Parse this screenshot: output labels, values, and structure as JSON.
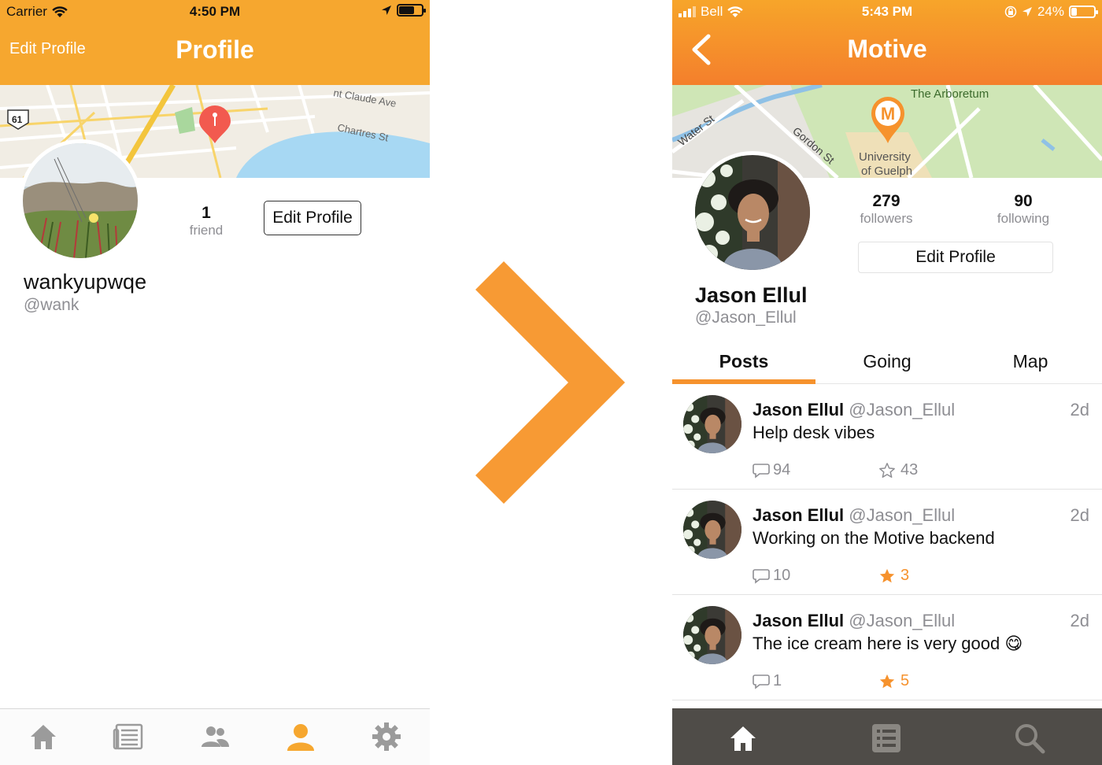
{
  "colors": {
    "accent": "#f6a72f",
    "accent_dark": "#f47f2c",
    "tab_active": "#f6922d",
    "dark_tabbar": "#4f4c48"
  },
  "left": {
    "status": {
      "carrier": "Carrier",
      "time": "4:50 PM"
    },
    "header": {
      "left_button": "Edit Profile",
      "title": "Profile"
    },
    "map": {
      "labels": [
        "Claude Ave",
        "Chartres St"
      ],
      "route_shield": "61"
    },
    "profile": {
      "stat_value": "1",
      "stat_label": "friend",
      "edit_button": "Edit Profile",
      "name": "wankyupwqe",
      "handle": "@wank"
    },
    "tabbar": {
      "icons": [
        "home-icon",
        "news-icon",
        "friends-icon",
        "profile-icon",
        "settings-icon"
      ],
      "active": "profile-icon"
    }
  },
  "right": {
    "status": {
      "carrier": "Bell",
      "time": "5:43 PM",
      "battery": "24%"
    },
    "header": {
      "title": "Motive"
    },
    "map": {
      "labels": [
        "Water St",
        "Gordon St",
        "The Arboretum",
        "University",
        "of Guelph"
      ],
      "pin_letter": "M"
    },
    "profile": {
      "followers_value": "279",
      "followers_label": "followers",
      "following_value": "90",
      "following_label": "following",
      "edit_button": "Edit Profile",
      "name": "Jason Ellul",
      "handle": "@Jason_Ellul"
    },
    "tabs": [
      "Posts",
      "Going",
      "Map"
    ],
    "posts": [
      {
        "name": "Jason Ellul",
        "handle": "@Jason_Ellul",
        "time": "2d",
        "text": "Help desk vibes",
        "comments": "94",
        "stars": "43",
        "starred": false
      },
      {
        "name": "Jason Ellul",
        "handle": "@Jason_Ellul",
        "time": "2d",
        "text": "Working on the Motive backend",
        "comments": "10",
        "stars": "3",
        "starred": true
      },
      {
        "name": "Jason Ellul",
        "handle": "@Jason_Ellul",
        "time": "2d",
        "text": "The ice cream here is very good 😋",
        "comments": "1",
        "stars": "5",
        "starred": true
      }
    ],
    "tabbar": {
      "icons": [
        "home-icon",
        "list-icon",
        "search-icon"
      ],
      "active": "home-icon"
    }
  }
}
